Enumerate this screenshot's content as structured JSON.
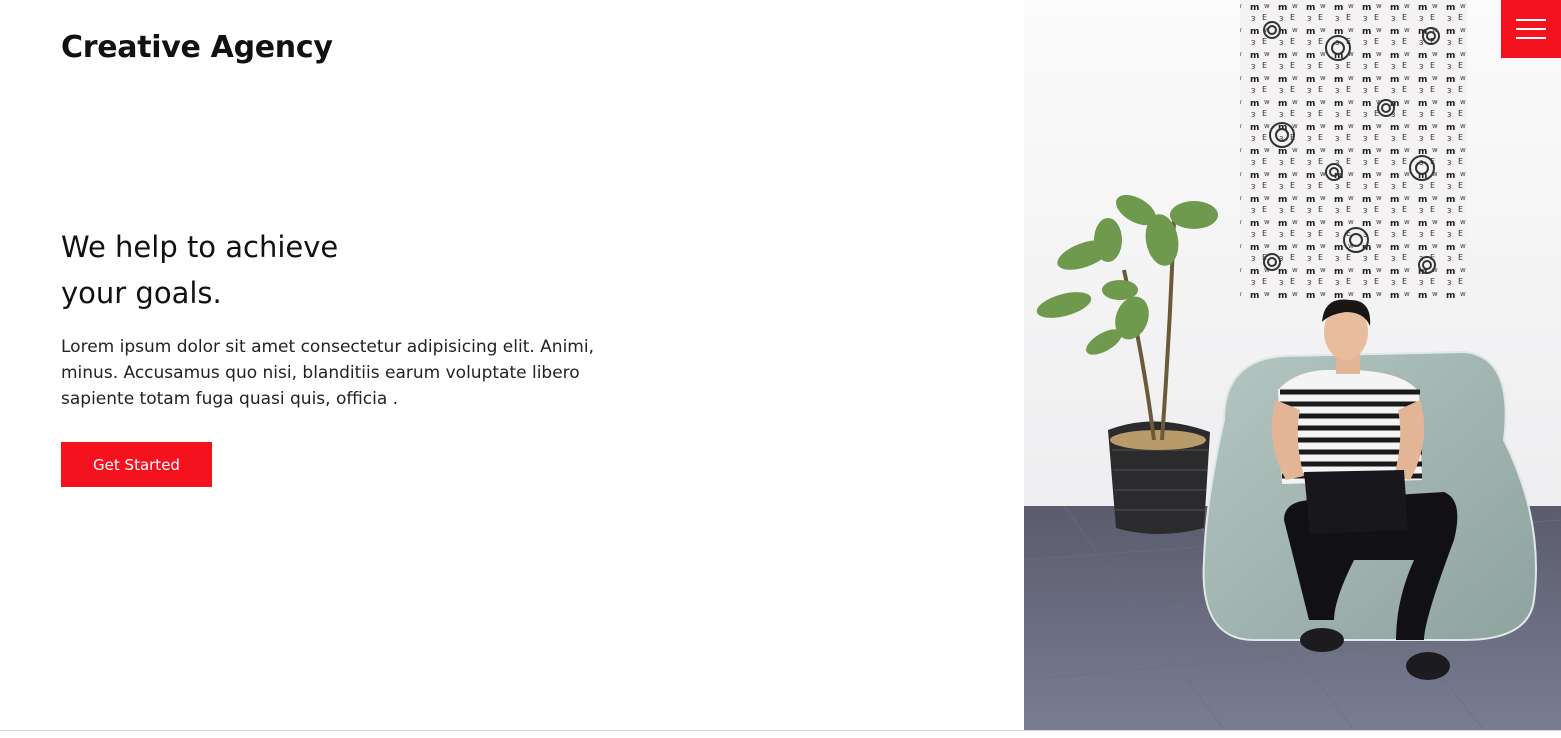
{
  "brand": {
    "name": "Creative Agency"
  },
  "hero": {
    "headline_line1": "We help to achieve",
    "headline_line2": "your goals.",
    "description": "Lorem ipsum dolor sit amet consectetur adipisicing elit. Animi, minus. Accusamus quo nisi, blanditiis earum voluptate libero sapiente totam fuga quasi quis, officia .",
    "cta_label": "Get Started"
  },
  "menu": {
    "icon": "hamburger-icon"
  },
  "image": {
    "subject": "person-with-laptop-on-beanbag-photo"
  },
  "colors": {
    "accent": "#f4121f",
    "text": "#111111",
    "background": "#ffffff"
  }
}
